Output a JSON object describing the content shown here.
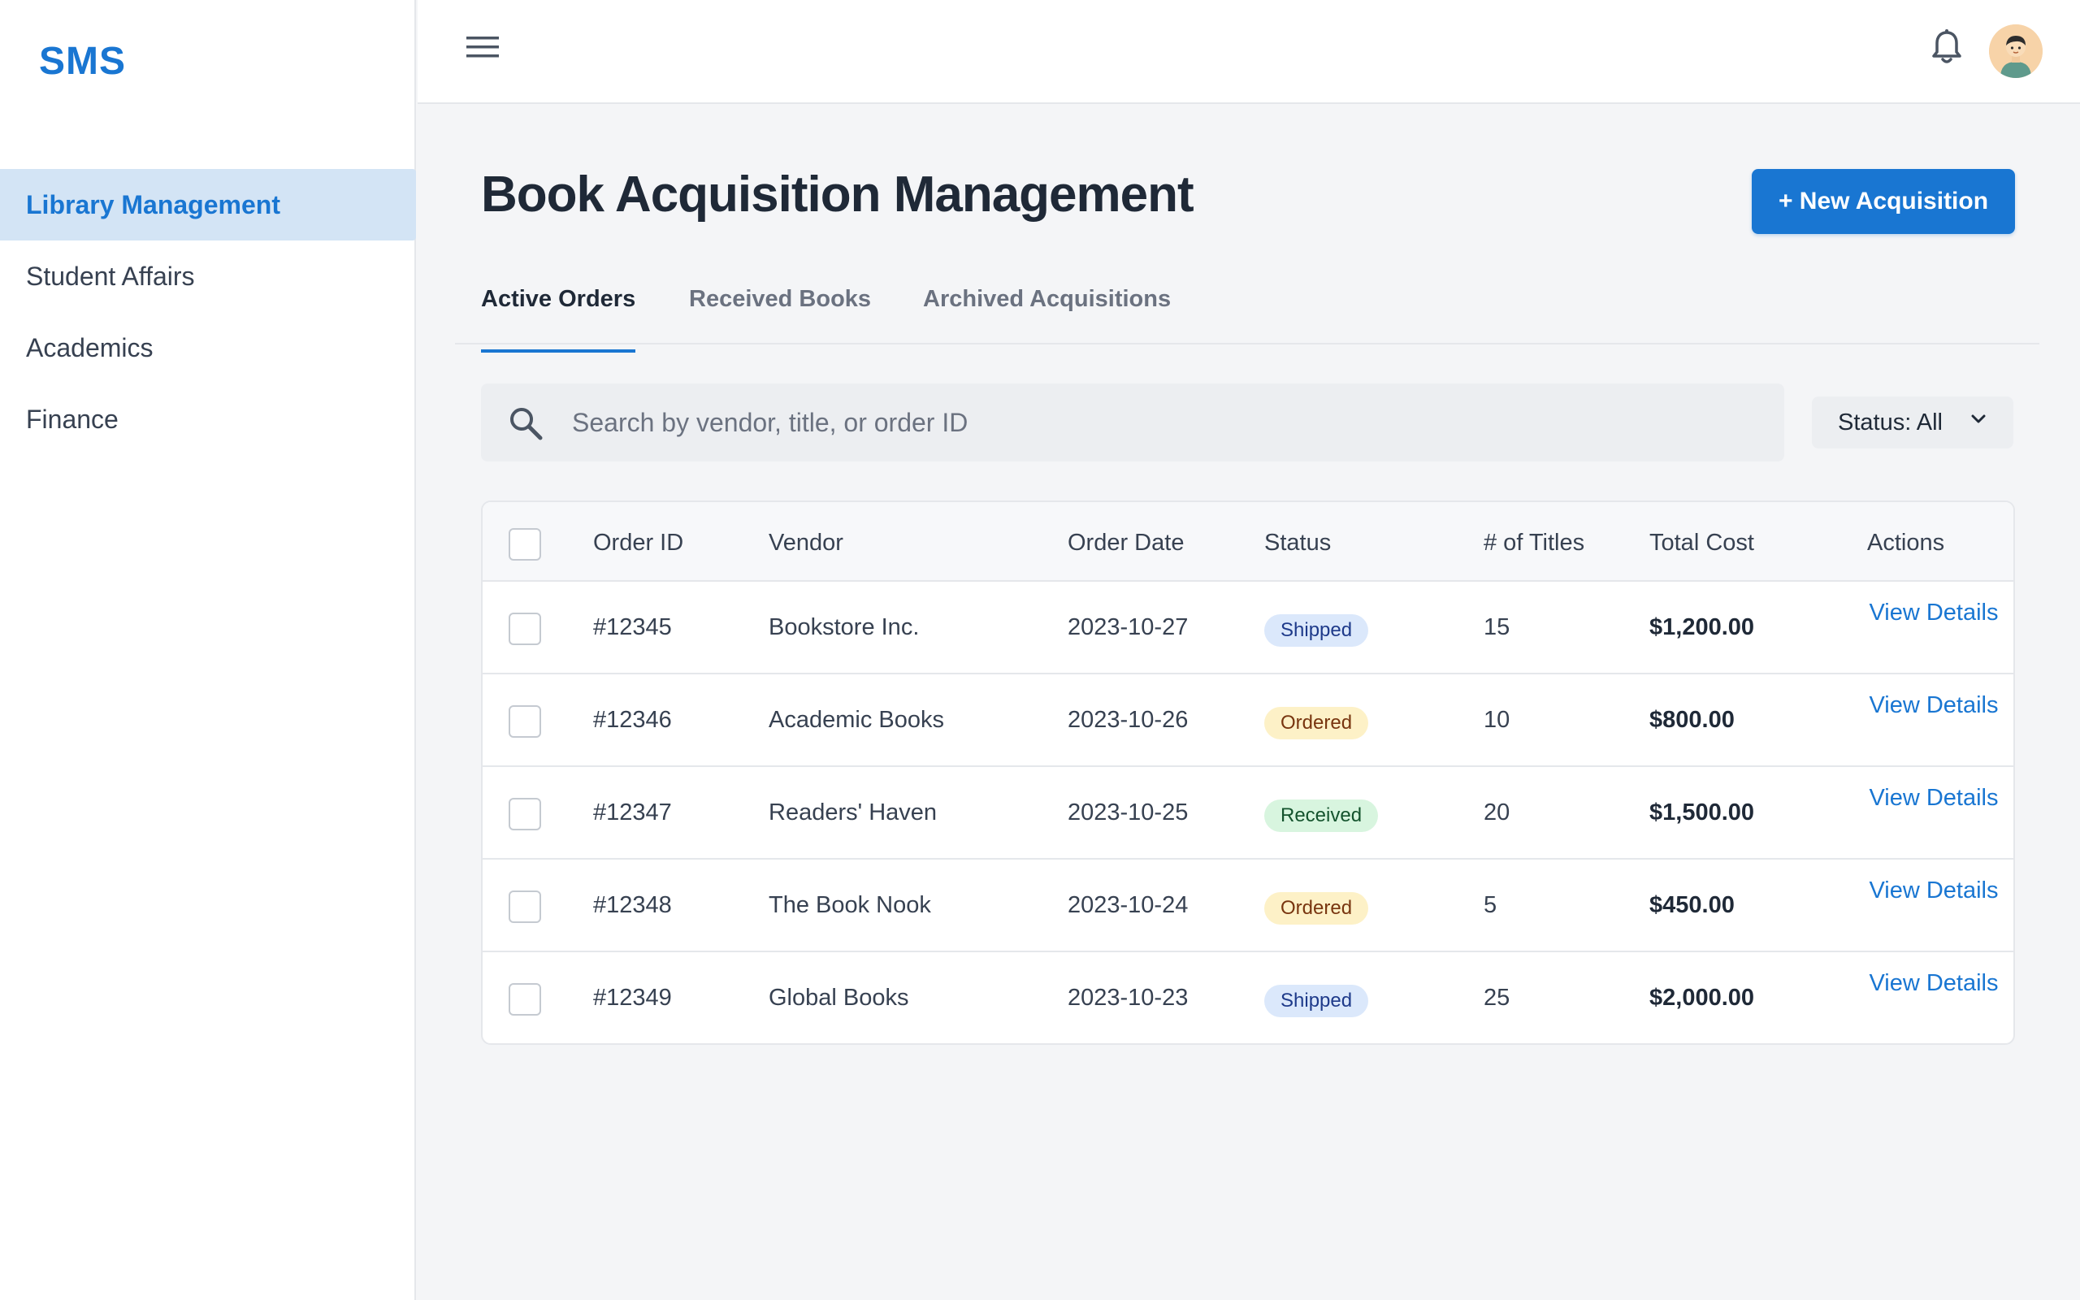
{
  "app": {
    "logo": "SMS"
  },
  "sidebar": {
    "items": [
      {
        "label": "Library Management",
        "active": true
      },
      {
        "label": "Student Affairs",
        "active": false
      },
      {
        "label": "Academics",
        "active": false
      },
      {
        "label": "Finance",
        "active": false
      }
    ]
  },
  "topbar": {
    "menu_icon": "hamburger-menu-icon",
    "notification_icon": "bell-icon",
    "avatar_icon": "user-avatar"
  },
  "page": {
    "title": "Book Acquisition Management",
    "new_button": "+ New Acquisition"
  },
  "tabs": [
    {
      "label": "Active Orders",
      "active": true
    },
    {
      "label": "Received Books",
      "active": false
    },
    {
      "label": "Archived Acquisitions",
      "active": false
    }
  ],
  "search": {
    "placeholder": "Search by vendor, title, or order ID",
    "value": ""
  },
  "filter": {
    "label": "Status: All"
  },
  "table": {
    "columns": [
      "Order ID",
      "Vendor",
      "Order Date",
      "Status",
      "# of Titles",
      "Total Cost",
      "Actions"
    ],
    "rows": [
      {
        "order_id": "#12345",
        "vendor": "Bookstore Inc.",
        "date": "2023-10-27",
        "status": "Shipped",
        "titles": "15",
        "cost": "$1,200.00",
        "action": "View Details"
      },
      {
        "order_id": "#12346",
        "vendor": "Academic Books",
        "date": "2023-10-26",
        "status": "Ordered",
        "titles": "10",
        "cost": "$800.00",
        "action": "View Details"
      },
      {
        "order_id": "#12347",
        "vendor": "Readers' Haven",
        "date": "2023-10-25",
        "status": "Received",
        "titles": "20",
        "cost": "$1,500.00",
        "action": "View Details"
      },
      {
        "order_id": "#12348",
        "vendor": "The Book Nook",
        "date": "2023-10-24",
        "status": "Ordered",
        "titles": "5",
        "cost": "$450.00",
        "action": "View Details"
      },
      {
        "order_id": "#12349",
        "vendor": "Global Books",
        "date": "2023-10-23",
        "status": "Shipped",
        "titles": "25",
        "cost": "$2,000.00",
        "action": "View Details"
      }
    ]
  },
  "colors": {
    "accent": "#1976d2",
    "sidebar_active_bg": "#d3e4f5",
    "shipped_bg": "#dbe8fb",
    "ordered_bg": "#fdf1c7",
    "received_bg": "#d8f5df"
  }
}
